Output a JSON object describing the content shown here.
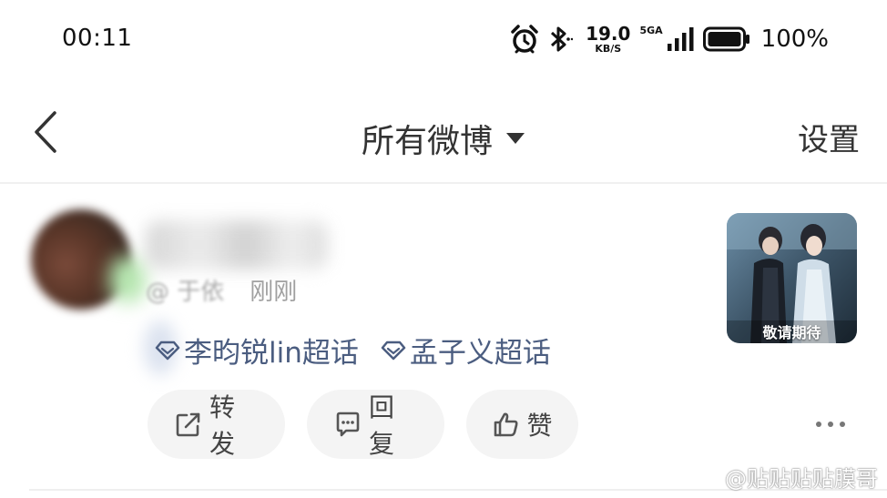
{
  "status_bar": {
    "time": "00:11",
    "net_speed_value": "19.0",
    "net_speed_unit": "KB/S",
    "signal_label": "5GA",
    "battery": "100%",
    "icons": [
      "alarm-icon",
      "bluetooth-icon",
      "signal-icon",
      "battery-icon"
    ]
  },
  "nav": {
    "back_icon": "chevron-left-icon",
    "title": "所有微博",
    "dropdown_icon": "caret-down-icon",
    "settings_label": "设置"
  },
  "post": {
    "source": "@ 于依",
    "time": "刚刚",
    "topics": [
      {
        "label": "李昀锐lin超话",
        "icon": "diamond-icon"
      },
      {
        "label": "孟子义超话",
        "icon": "diamond-icon"
      }
    ],
    "thumbnail_caption": "敬请期待",
    "actions": {
      "repost_label": "转发",
      "reply_label": "回复",
      "like_label": "赞"
    },
    "more_icon": "more-dots-icon"
  },
  "watermark": {
    "text": "@贴贴贴贴膜哥",
    "icon": "weibo-logo-icon"
  },
  "colors": {
    "topic_link": "#4b5d80",
    "action_bg": "#f4f4f4",
    "muted_text": "#9a9a9a"
  }
}
